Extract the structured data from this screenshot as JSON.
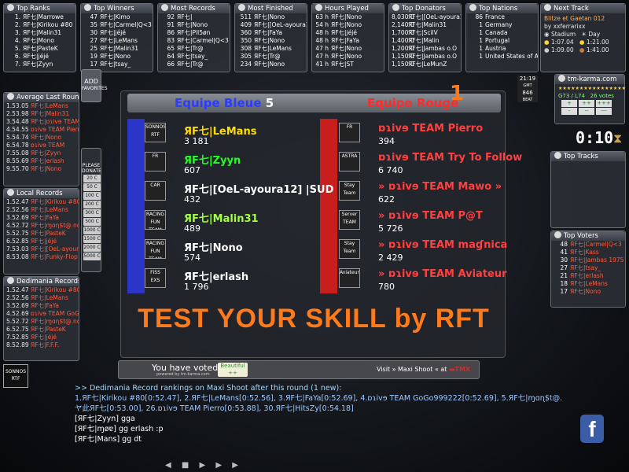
{
  "top_widgets": [
    {
      "title": "Top Ranks",
      "rows": [
        [
          "1.",
          "ЯF七|Marrowe"
        ],
        [
          "2.",
          "ЯF七|Kirikou #80"
        ],
        [
          "3.",
          "ЯF七|Malin31"
        ],
        [
          "4.",
          "ЯF七|Mono"
        ],
        [
          "5.",
          "ЯF七|PasteK"
        ],
        [
          "6.",
          "ЯF七|jéjé"
        ],
        [
          "7.",
          "ЯF七|Zyyn"
        ]
      ]
    },
    {
      "title": "Top Winners",
      "rows": [
        [
          "47",
          "ЯF七|Kimo"
        ],
        [
          "35",
          "ЯF七|Carmel|Q<3"
        ],
        [
          "30",
          "ЯF七|jéjé"
        ],
        [
          "27",
          "ЯF七|LeMans"
        ],
        [
          "25",
          "ЯF七|Malin31"
        ],
        [
          "19",
          "ЯF七|Nono"
        ],
        [
          "17",
          "ЯF七|tsay_"
        ]
      ]
    },
    {
      "title": "Most Records",
      "rows": [
        [
          "92",
          "ЯF七|"
        ],
        [
          "91",
          "ЯF七|Nono"
        ],
        [
          "86",
          "ЯF七|Pll5øn"
        ],
        [
          "83",
          "ЯF七|Carmel|Q<3"
        ],
        [
          "65",
          "ЯF七|Tr@"
        ],
        [
          "64",
          "ЯF七|tsay_"
        ],
        [
          "66",
          "ЯF七|Tr@"
        ]
      ]
    },
    {
      "title": "Most Finished",
      "rows": [
        [
          "511",
          "ЯF七|Nono"
        ],
        [
          "409",
          "ЯF七|[OeL-ayoura12] |SUD"
        ],
        [
          "360",
          "ЯF七|FaYa"
        ],
        [
          "350",
          "ЯF七|Nono"
        ],
        [
          "308",
          "ЯF七|LeMans"
        ],
        [
          "305",
          "ЯF七|Tr@"
        ],
        [
          "234",
          "ЯF七|Nono"
        ]
      ]
    },
    {
      "title": "Hours Played",
      "rows": [
        [
          "63 h",
          "ЯF七|Nono"
        ],
        [
          "54 h",
          "ЯF七|Nono"
        ],
        [
          "48 h",
          "ЯF七|jéjé"
        ],
        [
          "48 h",
          "ЯF七|FaYa"
        ],
        [
          "47 h",
          "ЯF七|Nono"
        ],
        [
          "47 h",
          "ЯF七|Nono"
        ],
        [
          "41 h",
          "ЯF七|ST"
        ]
      ]
    },
    {
      "title": "Top Donators",
      "rows": [
        [
          "8,030 C",
          "ЯF七|[OeL-ayoura12] |SUD"
        ],
        [
          "2,140 C",
          "ЯF七|Malin31"
        ],
        [
          "1,700 C",
          "ЯF七|ScilV"
        ],
        [
          "1,400 C",
          "ЯF七|Malin"
        ],
        [
          "1,200 C",
          "ЯF七|Jambas o.O"
        ],
        [
          "1,150 C",
          "ЯF七|Jambas o.O"
        ],
        [
          "1,150 C",
          "ЯF七|LeMunZ"
        ]
      ]
    },
    {
      "title": "Top Nations",
      "rows": [
        [
          "86",
          "France"
        ],
        [
          "1",
          "Germany"
        ],
        [
          "1",
          "Canada"
        ],
        [
          "1",
          "Portugal"
        ],
        [
          "1",
          "Austria"
        ],
        [
          "1",
          "United States of America"
        ]
      ]
    }
  ],
  "next_track": {
    "title": "Next Track",
    "name": "Blitze et Gaetan 012",
    "author": "by xxferrarixx",
    "env": "Stadium",
    "mood": "Day",
    "times": [
      [
        "1:07.04",
        "1:21.00"
      ],
      [
        "1:09.00",
        "1:41.00"
      ]
    ]
  },
  "left_widgets": [
    {
      "title": "Average Last Round",
      "rows": [
        [
          "1.",
          "53.05",
          "ЯF七|LeMans"
        ],
        [
          "2.",
          "53.98",
          "ЯF七|Malin31"
        ],
        [
          "3.",
          "54.48",
          "ЯF七|ɒɿivɘ TEAM"
        ],
        [
          "4.",
          "54.55",
          "ɒɿivɘ TEAM Pierro"
        ],
        [
          "5.",
          "54.74",
          "ЯF七|Nono"
        ],
        [
          "6.",
          "54.78",
          "ɒɿivɘ TEAM"
        ],
        [
          "7.",
          "55.08",
          "ЯF七|Zyyn"
        ],
        [
          "8.",
          "55.69",
          "ЯF七|erlash"
        ],
        [
          "9.",
          "55.70",
          "ЯF七|Nono"
        ]
      ]
    },
    {
      "title": "Local Records",
      "rows": [
        [
          "1.",
          "52.47",
          "ЯF七|Kirikou #80"
        ],
        [
          "2.",
          "52.56",
          "ЯF七|LeMans"
        ],
        [
          "3.",
          "52.69",
          "ЯF七|FaYa"
        ],
        [
          "4.",
          "52.72",
          "ЯF七|ɱɑɳ$t@.no"
        ],
        [
          "5.",
          "52.75",
          "ЯF七|PasteK"
        ],
        [
          "6.",
          "52.85",
          "ЯF七|jéjé"
        ],
        [
          "7.",
          "53.03",
          "ЯF七|[OeL-ayoura12] |SUD"
        ],
        [
          "8.",
          "53.08",
          "ЯF七|Funky-Flop"
        ]
      ]
    },
    {
      "title": "Dedimania Records",
      "rows": [
        [
          "1.",
          "52.47",
          "ЯF七|Kirikou #80"
        ],
        [
          "2.",
          "52.56",
          "ЯF七|LeMans"
        ],
        [
          "3.",
          "52.69",
          "ЯF七|FaYa"
        ],
        [
          "4.",
          "52.69",
          "ɒɿivɘ TEAM GoGo"
        ],
        [
          "5.",
          "52.72",
          "ЯF七|ɱɑɳ$t@.no"
        ],
        [
          "6.",
          "52.75",
          "ЯF七|PasteK"
        ],
        [
          "7.",
          "52.85",
          "ЯF七|jéjé"
        ],
        [
          "8.",
          "52.89",
          "ЯF七|F.F.F."
        ]
      ]
    }
  ],
  "right_widgets": [
    {
      "title": "Top Tracks",
      "rows": []
    },
    {
      "title": "Top Voters",
      "rows": [
        [
          "48",
          "ЯF七|Carmel|Q<3"
        ],
        [
          "41",
          "ЯF七|Kass"
        ],
        [
          "30",
          "ЯF七|Jambas 1975"
        ],
        [
          "27",
          "ЯF七|tsay_"
        ],
        [
          "21",
          "ЯF七|erlash"
        ],
        [
          "18",
          "ЯF七|LeMans"
        ],
        [
          "17",
          "ЯF七|Nono"
        ]
      ]
    }
  ],
  "karma": {
    "title": "tm-karma.com",
    "summary": "G73 / L74",
    "votes": "26 votes",
    "buttons": [
      "+",
      "++",
      "+++",
      "-",
      "--",
      "---"
    ]
  },
  "clock": {
    "time": "21:19",
    "label": "GMT",
    "count": "846",
    "count_label": "BEAT"
  },
  "countdown": "0:10",
  "add_button": {
    "label": "ADD",
    "sub": "FAVORITES"
  },
  "donate": {
    "label": "PLEASE DONATE",
    "amounts": [
      "20 C",
      "50 C",
      "100 C",
      "200 C",
      "300 C",
      "500 C",
      "1000 C",
      "1500 C",
      "2000 C",
      "5000 C"
    ]
  },
  "match": {
    "blue": {
      "name": "Equipe Bleue",
      "score": "5"
    },
    "red": {
      "name": "Equipe Rouge",
      "score": "1"
    },
    "blue_players": [
      {
        "name": "ЯF七|LeMans",
        "pts": "3 181",
        "color": "#ffdd00",
        "logo": "SONNOS RTF"
      },
      {
        "name": "ЯF七|Zyyn",
        "pts": "607",
        "color": "#22ff22",
        "logo": "FR"
      },
      {
        "name": "ЯF七|[OeL-ayoura12] |SUD",
        "pts": "432",
        "color": "#ffffff",
        "logo": "CAR"
      },
      {
        "name": "ЯF七|Malin31",
        "pts": "489",
        "color": "#a0ff40",
        "logo": "RACING FUN TEAM"
      },
      {
        "name": "ЯF七|Nono",
        "pts": "574",
        "color": "#ffffff",
        "logo": "RACING FUN TEAM"
      },
      {
        "name": "ЯF七|erlash",
        "pts": "1 796",
        "color": "#ffffff",
        "logo": "FISS EXS"
      }
    ],
    "red_players": [
      {
        "name": "ɒɿivɘ TEAM Pierro",
        "pts": "394",
        "color": "#ff4040",
        "logo": "FR"
      },
      {
        "name": "ɒɿivɘ TEAM Try To Follow",
        "pts": "6 740",
        "color": "#ff4040",
        "logo": "ASTRA"
      },
      {
        "name": "» ɒɿivɘ TEAM Mawo »",
        "pts": "622",
        "color": "#ff4040",
        "logo": "Stay Team"
      },
      {
        "name": "» ɒɿivɘ TEAM P@T",
        "pts": "5 726",
        "color": "#ff4040",
        "logo": "Server TEAM"
      },
      {
        "name": "» ɒɿivɘ TEAM maɠnica",
        "pts": "2 429",
        "color": "#ff4040",
        "logo": "Stay Team"
      },
      {
        "name": "» ɒɿivɘ TEAM Aviateur",
        "pts": "780",
        "color": "#ff4040",
        "logo": "Aviateur"
      }
    ],
    "banner": "TEST YOUR SKILL by RFT"
  },
  "vote": {
    "text": "You have voted:",
    "sub": "powered by tm-karma.com",
    "button": "Beautiful ++",
    "visit": "Visit » Maxi Shoot « at"
  },
  "chat": {
    "lines": [
      {
        "text": ">> Dedimania Record rankings on Maxi Shoot after this round (1 new):",
        "color": "#a0d8ff"
      },
      {
        "text": "1.ЯF七|Kirikou #80[0:52.47], 2.ЯF七|LeMans[0:52.56], 3.ЯF七|FaYa[0:52.69], 4.ɒɿivɘ TEAM GoGo999222[0:52.69], 5.ЯF七|ɱɑɳ$t@.no[0:52.72], 6.ЯF七|PasteK[0:52.75], 7.ЯF七|jéjé[0:52.85], 8.F.F.F.",
        "color": "#9fc8ff"
      },
      {
        "text": "ヤ此ЯF七[0:53.00], 26.ɒɿivɘ TEAM Pierro[0:53.88], 30.ЯF七|HitsZy[0:54.18]",
        "color": "#9fc8ff"
      },
      {
        "text": "[ЯF七|Zyyn] gga",
        "color": "#ffffff"
      },
      {
        "text": "[ЯF七|ɱøɐ] gg erlash :p",
        "color": "#ffffff"
      },
      {
        "text": "[ЯF七|Mans] gg dt",
        "color": "#ffffff"
      }
    ]
  },
  "toolbar": {
    "icons": "◀ ■ ▶ ▶ ▶"
  },
  "corner_logo": "SONNOS RTF",
  "facebook": "f",
  "colors": {
    "accent": "#ff7a1a",
    "blue_team": "#2b36c8",
    "red_team": "#c81e1e"
  }
}
